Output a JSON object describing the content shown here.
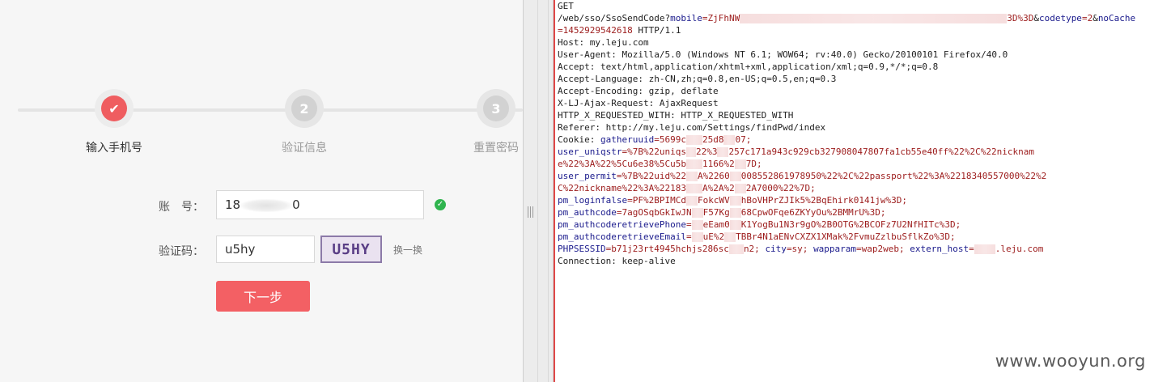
{
  "steps": [
    {
      "label": "输入手机号",
      "icon": "check-icon",
      "state": "done"
    },
    {
      "label": "验证信息",
      "number": "2",
      "state": "pending"
    },
    {
      "label": "重置密码",
      "number": "3",
      "state": "pending"
    }
  ],
  "form": {
    "account_label": "账　号：",
    "account_prefix": "18",
    "account_suffix": "0",
    "captcha_label": "验证码：",
    "captcha_value": "u5hy",
    "captcha_image_text": "U5HY",
    "refresh_label": "换一换",
    "next_label": "下一步"
  },
  "request": {
    "method": "GET",
    "path_start": "/web/sso/SsoSendCode?",
    "mobile_key": "mobile",
    "mobile_value_start": "ZjFhNW",
    "mobile_value_end": "3D%3D",
    "codetype_key": "codetype",
    "codetype_value": "2",
    "nocache_key": "noCache",
    "nocache_value": "=1452929542618",
    "protocol": " HTTP/1.1",
    "host": "Host: my.leju.com",
    "user_agent": "User-Agent: Mozilla/5.0 (Windows NT 6.1; WOW64; rv:40.0) Gecko/20100101 Firefox/40.0",
    "accept": "Accept: text/html,application/xhtml+xml,application/xml;q=0.9,*/*;q=0.8",
    "accept_language": "Accept-Language: zh-CN,zh;q=0.8,en-US;q=0.5,en;q=0.3",
    "accept_encoding": "Accept-Encoding: gzip, deflate",
    "ajax": "X-LJ-Ajax-Request: AjaxRequest",
    "xrw": "HTTP_X_REQUESTED_WITH: HTTP_X_REQUESTED_WITH",
    "referer": "Referer: http://my.leju.com/Settings/findPwd/index",
    "cookie_label": "Cookie: ",
    "gatheruuid_key": "gatheruuid",
    "gatheruuid_value": "=5699c",
    "gatheruuid_end": "25d8",
    "gatheruuid_tail": "07;",
    "uniqstr_key": "user_uniqstr",
    "uniqstr_value_1": "=%7B%22uniqs",
    "uniqstr_value_2": "22%3",
    "uniqstr_value_3": "257c171a943c929cb327908047807fa1cb55e40ff%22%2C%22nicknam",
    "uniqstr_line2_a": "e%22%3A%22%5Cu6e38%5Cu5b",
    "uniqstr_line2_b": "1166%2",
    "uniqstr_line2_c": "7D;",
    "permit_key": "user_permit",
    "permit_value_1": "=%7B%22uid%22",
    "permit_value_2": "A%2260",
    "permit_value_3": "008552861978950%22%2C%22passport%22%3A%2218340557000%22%2",
    "permit_line2_a": "C%22nickname%22%3A%22183",
    "permit_line2_b": "A%2A%2",
    "permit_line2_c": "2A7000%22%7D;",
    "loginfalse_key": "pm_loginfalse",
    "loginfalse_value_1": "=PF%2BPIMCd",
    "loginfalse_value_2": "Fokc",
    "loginfalse_value_3": "WV",
    "loginfalse_value_4": "hBoVHPrZJIk5%2BqEhirk0141jw%3D;",
    "authcode_key": "pm_authcode",
    "authcode_value_1": "=7agOSqbGkIwJN",
    "authcode_value_2": "F57Kg",
    "authcode_value_3": "68CpwOFqe6ZKYyOu%2BMMrU%3D;",
    "phone_key": "pm_authcoderetrievePhone",
    "phone_value_1": "=",
    "phone_value_2": "eEam0",
    "phone_value_3": "K1YogBu1N3r9gO%2B0OTG%2BCOFz7U2NfHITc%3D;",
    "email_key": "pm_authcoderetrieveEmail",
    "email_value_1": "=",
    "email_value_2": "uE%2",
    "email_value_3": "TBBr4N1aENvCXZX1XMak%2FvmuZzlbuSflkZo%3D;",
    "phpsessid_key": "PHPSESSID",
    "phpsessid_value_1": "=b71j23rt4945hchjs286sc",
    "phpsessid_value_2": "n2; ",
    "city_key": "city",
    "city_value": "=sy; ",
    "wapparam_key": "wapparam",
    "wapparam_value": "=wap2web; ",
    "extern_key": "extern_host",
    "extern_value_1": "=",
    "extern_value_2": ".leju.com",
    "connection": "Connection: keep-alive"
  },
  "watermark": "www.wooyun.org",
  "colors": {
    "accent": "#f36064",
    "success": "#2fb44e",
    "header_key": "#1a1a8c",
    "header_value": "#9c1b1b"
  }
}
